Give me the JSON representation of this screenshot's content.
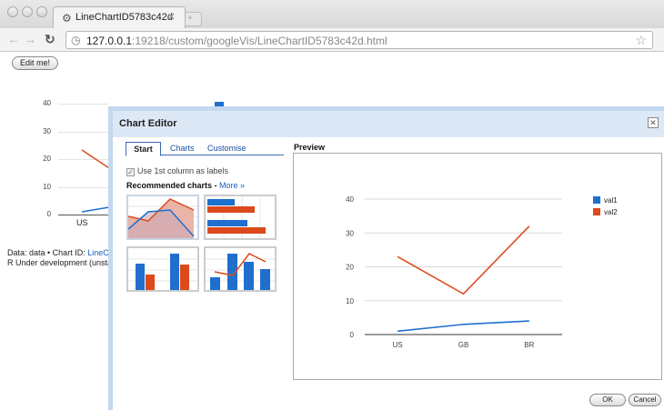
{
  "browser": {
    "tab_title": "LineChartID5783c42d",
    "url_host": "127.0.0.1",
    "url_rest": ":19218/custom/googleVis/LineChartID5783c42d.html"
  },
  "page": {
    "edit_button": "Edit me!",
    "bg_ticks": [
      "40",
      "30",
      "20",
      "10",
      "0"
    ],
    "bg_category": "US",
    "bg_legend_partial": "val1",
    "note_line1_prefix": "Data: data • Chart ID: ",
    "note_line1_link": "LineCh",
    "note_line2": "R Under development (unsta"
  },
  "dialog": {
    "title": "Chart Editor",
    "tabs": [
      "Start",
      "Charts",
      "Customise"
    ],
    "use_first_column": "Use 1st column as labels",
    "recommended": "Recommended charts - ",
    "more_link": "More »",
    "preview_label": "Preview",
    "ok": "OK",
    "cancel": "Cancel"
  },
  "colors": {
    "val1": "#1f6fce",
    "val2": "#dc4a1b"
  },
  "chart_data": {
    "type": "line",
    "categories": [
      "US",
      "GB",
      "BR"
    ],
    "series": [
      {
        "name": "val1",
        "values": [
          1,
          3,
          4
        ]
      },
      {
        "name": "val2",
        "values": [
          23,
          12,
          32
        ]
      }
    ],
    "ylim": [
      0,
      40
    ],
    "yticks": [
      0,
      10,
      20,
      30,
      40
    ],
    "grid": true,
    "legend": "right"
  }
}
